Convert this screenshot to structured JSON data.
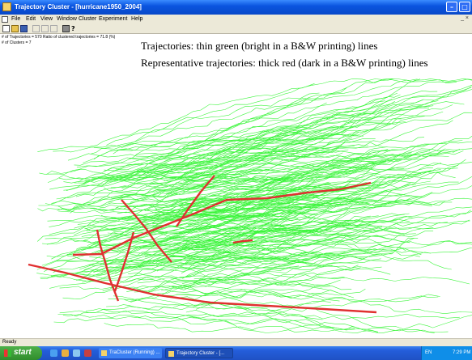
{
  "window": {
    "title": "Trajectory Cluster - [hurricane1950_2004]",
    "min_glyph": "–",
    "max_glyph": "□"
  },
  "menu": {
    "items": [
      "File",
      "Edit",
      "View",
      "Window",
      "Cluster",
      "Experiment",
      "Help"
    ],
    "mdi_controls": "_ ×"
  },
  "toolbar": {
    "icons": [
      "new-icon",
      "open-icon",
      "save-icon",
      "cut-icon",
      "copy-icon",
      "paste-icon",
      "print-icon",
      "help-icon"
    ]
  },
  "stats": {
    "line1": "# of Trajectories = 570   Ratio of clustered trajectories = 71.8 (%)",
    "line2": "# of Clusters = 7"
  },
  "legend": {
    "line1": "Trajectories: thin green (bright in a B&W printing) lines",
    "line2": "Representative trajectories: thick red (dark in a B&W printing) lines"
  },
  "plot": {
    "trajectory_color": "#3cf53c",
    "representative_color": "#e03030",
    "trajectory_count": 570
  },
  "status": {
    "text": "Ready"
  },
  "taskbar": {
    "start": "start",
    "tasks": [
      "TraCluster (Running) ...",
      "Trajectory Cluster - [..."
    ],
    "tray_lang": "EN",
    "clock": "7:29 PM"
  },
  "colors": {
    "titlebar": "#0a55e0",
    "chrome": "#ece9d8",
    "taskbar": "#245edb",
    "start": "#2f8d2c"
  }
}
